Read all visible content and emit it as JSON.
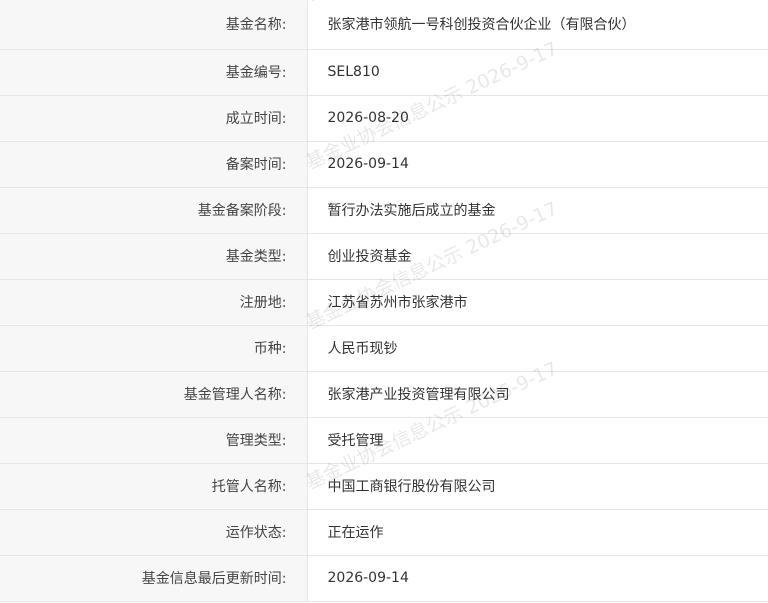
{
  "fund_info": {
    "rows": [
      {
        "label": "基金名称:",
        "value": "张家港市领航一号科创投资合伙企业（有限合伙）"
      },
      {
        "label": "基金编号:",
        "value": "SEL810"
      },
      {
        "label": "成立时间:",
        "value": "2026-08-20"
      },
      {
        "label": "备案时间:",
        "value": "2026-09-14"
      },
      {
        "label": "基金备案阶段:",
        "value": "暂行办法实施后成立的基金"
      },
      {
        "label": "基金类型:",
        "value": "创业投资基金"
      },
      {
        "label": "注册地:",
        "value": "江苏省苏州市张家港市"
      },
      {
        "label": "币种:",
        "value": "人民币现钞"
      },
      {
        "label": "基金管理人名称:",
        "value": "张家港产业投资管理有限公司"
      },
      {
        "label": "管理类型:",
        "value": "受托管理"
      },
      {
        "label": "托管人名称:",
        "value": "中国工商银行股份有限公司"
      },
      {
        "label": "运作状态:",
        "value": "正在运作"
      },
      {
        "label": "基金信息最后更新时间:",
        "value": "2026-09-14"
      }
    ]
  },
  "watermark": {
    "text": "基金业协会信息公示 2026-9-17"
  }
}
